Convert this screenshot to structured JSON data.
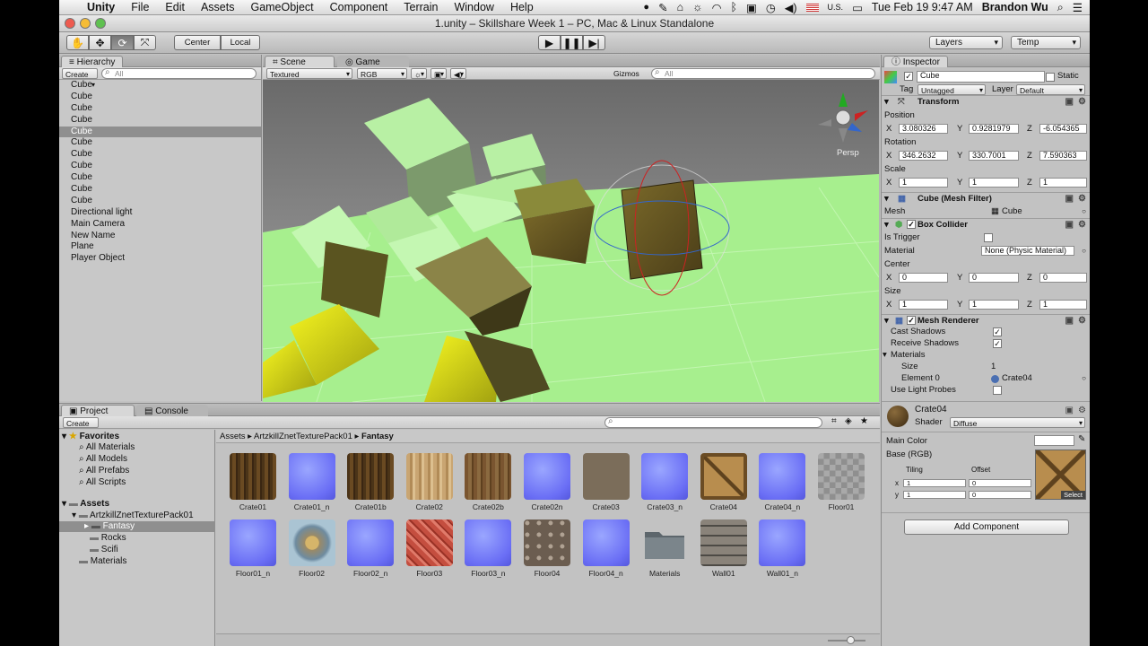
{
  "menubar": {
    "app": "Unity",
    "items": [
      "File",
      "Edit",
      "Assets",
      "GameObject",
      "Component",
      "Terrain",
      "Window",
      "Help"
    ],
    "flag": "U.S.",
    "clock": "Tue Feb 19  9:47 AM",
    "user": "Brandon Wu"
  },
  "window_title": "1.unity – Skillshare Week 1 – PC, Mac & Linux Standalone",
  "toolbar": {
    "pivot": "Center",
    "space": "Local",
    "layers": "Layers",
    "layout": "Temp"
  },
  "hierarchy": {
    "tab": "Hierarchy",
    "create": "Create",
    "search_placeholder": "All",
    "items": [
      "Cube",
      "Cube",
      "Cube",
      "Cube",
      "Cube",
      "Cube",
      "Cube",
      "Cube",
      "Cube",
      "Cube",
      "Cube",
      "Directional light",
      "Main Camera",
      "New Name",
      "Plane",
      "Player Object"
    ]
  },
  "scene": {
    "tabs": [
      "Scene",
      "Game"
    ],
    "shading": "Textured",
    "render": "RGB",
    "gizmos": "Gizmos",
    "search_placeholder": "All",
    "persp": "Persp"
  },
  "inspector": {
    "tab": "Inspector",
    "object_name": "Cube",
    "static_label": "Static",
    "tag_label": "Tag",
    "tag": "Untagged",
    "layer_label": "Layer",
    "layer": "Default",
    "transform": {
      "title": "Transform",
      "position_label": "Position",
      "rotation_label": "Rotation",
      "scale_label": "Scale",
      "position": [
        "3.080326",
        "0.9281979",
        "-6.054365"
      ],
      "rotation": [
        "346.2632",
        "330.7001",
        "7.590363"
      ],
      "scale": [
        "1",
        "1",
        "1"
      ]
    },
    "mesh_filter": {
      "title": "Cube (Mesh Filter)",
      "mesh_label": "Mesh",
      "mesh": "Cube"
    },
    "box_collider": {
      "title": "Box Collider",
      "is_trigger": "Is Trigger",
      "material_label": "Material",
      "material": "None (Physic Material)",
      "center_label": "Center",
      "size_label": "Size",
      "center": [
        "0",
        "0",
        "0"
      ],
      "size": [
        "1",
        "1",
        "1"
      ]
    },
    "mesh_renderer": {
      "title": "Mesh Renderer",
      "cast": "Cast Shadows",
      "receive": "Receive Shadows",
      "materials": "Materials",
      "size_label": "Size",
      "size": "1",
      "element_label": "Element 0",
      "element": "Crate04",
      "light_probes": "Use Light Probes"
    },
    "material": {
      "name": "Crate04",
      "shader_label": "Shader",
      "shader": "Diffuse",
      "main_color": "Main Color",
      "base": "Base (RGB)",
      "tiling": "Tiling",
      "offset": "Offset",
      "tiling_x": "1",
      "tiling_y": "1",
      "offset_x": "0",
      "offset_y": "0",
      "select": "Select"
    },
    "add_component": "Add Component"
  },
  "project": {
    "tabs": [
      "Project",
      "Console"
    ],
    "create": "Create",
    "breadcrumb": [
      "Assets",
      "ArtzkillZnetTexturePack01",
      "Fantasy"
    ],
    "favorites": {
      "title": "Favorites",
      "items": [
        "All Materials",
        "All Models",
        "All Prefabs",
        "All Scripts"
      ]
    },
    "assets_tree": {
      "root": "Assets",
      "pack": "ArtzkillZnetTexturePack01",
      "children": [
        "Fantasy",
        "Rocks",
        "Scifi"
      ],
      "materials": "Materials"
    },
    "assets": [
      {
        "name": "Crate01",
        "style": "wood"
      },
      {
        "name": "Crate01_n",
        "style": "blue"
      },
      {
        "name": "Crate01b",
        "style": "wood"
      },
      {
        "name": "Crate02",
        "style": "lwood"
      },
      {
        "name": "Crate02b",
        "style": "mwood"
      },
      {
        "name": "Crate02n",
        "style": "blue"
      },
      {
        "name": "Crate03",
        "style": "stone"
      },
      {
        "name": "Crate03_n",
        "style": "blue"
      },
      {
        "name": "Crate04",
        "style": "crate"
      },
      {
        "name": "Crate04_n",
        "style": "blue"
      },
      {
        "name": "Floor01",
        "style": "floor"
      },
      {
        "name": "Floor01_n",
        "style": "blue"
      },
      {
        "name": "Floor02",
        "style": "sandtile"
      },
      {
        "name": "Floor02_n",
        "style": "blue"
      },
      {
        "name": "Floor03",
        "style": "red"
      },
      {
        "name": "Floor03_n",
        "style": "blue"
      },
      {
        "name": "Floor04",
        "style": "cobble"
      },
      {
        "name": "Floor04_n",
        "style": "blue"
      },
      {
        "name": "Materials",
        "style": "folder"
      },
      {
        "name": "Wall01",
        "style": "brick"
      },
      {
        "name": "Wall01_n",
        "style": "blue"
      }
    ]
  },
  "colors": {
    "selection": "#8f8f8f",
    "ground": "#a8f08e",
    "normal_map": "#6a6ef5"
  }
}
